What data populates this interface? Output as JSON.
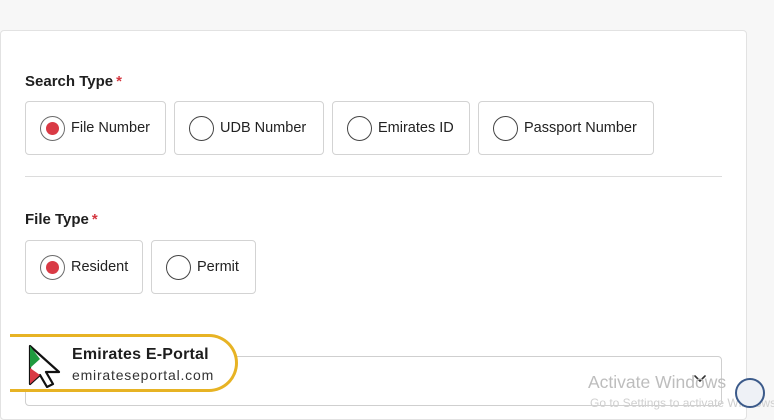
{
  "search_type": {
    "label": "Search Type",
    "required_mark": "*",
    "options": [
      {
        "label": "File Number",
        "selected": true
      },
      {
        "label": "UDB Number",
        "selected": false
      },
      {
        "label": "Emirates ID",
        "selected": false
      },
      {
        "label": "Passport Number",
        "selected": false
      }
    ]
  },
  "file_type": {
    "label": "File Type",
    "required_mark": "*",
    "options": [
      {
        "label": "Resident",
        "selected": true
      },
      {
        "label": "Permit",
        "selected": false
      }
    ]
  },
  "logo": {
    "title": "Emirates E-Portal",
    "url": "emirateseportal.com"
  },
  "watermark": {
    "title": "Activate Windows",
    "subtitle": "Go to Settings to activate Windows."
  },
  "colors": {
    "accent": "#d93a45",
    "badge_border": "#e7b324"
  }
}
